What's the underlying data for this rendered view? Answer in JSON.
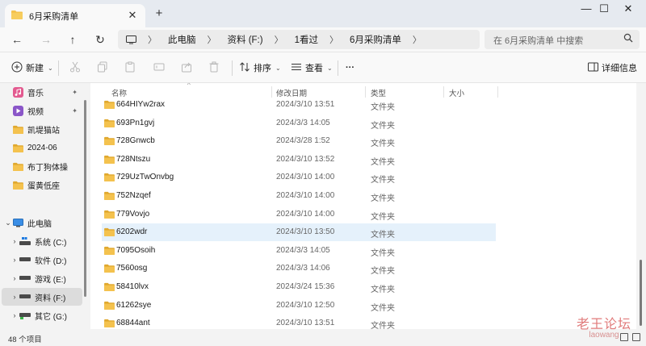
{
  "tab": {
    "title": "6月采购清单",
    "close": "✕",
    "new_tab": "+"
  },
  "window": {
    "minimize": "—",
    "maximize": "☐",
    "close": "✕"
  },
  "nav": {
    "back": "←",
    "forward": "→",
    "up": "↑",
    "refresh": "↻"
  },
  "breadcrumb": [
    "此电脑",
    "资料 (F:)",
    "1看过",
    "6月采购清单"
  ],
  "breadcrumb_sep": "〉",
  "search": {
    "placeholder": "在 6月采购清单 中搜索"
  },
  "toolbar": {
    "new_label": "新建",
    "sort_label": "排序",
    "view_label": "查看",
    "more_label": "···",
    "details_label": "详细信息",
    "caret": "⌄"
  },
  "sidebar": {
    "pinned": [
      {
        "label": "音乐",
        "icon": "music-icon",
        "pinned": true
      },
      {
        "label": "视频",
        "icon": "video-icon",
        "pinned": true
      },
      {
        "label": "凯堤猫站",
        "icon": "folder-icon",
        "pinned": false
      },
      {
        "label": "2024-06",
        "icon": "folder-icon",
        "pinned": false
      },
      {
        "label": "布丁狗体操",
        "icon": "folder-icon",
        "pinned": false
      },
      {
        "label": "蛋黄低座",
        "icon": "folder-icon",
        "pinned": false
      }
    ],
    "this_pc": "此电脑",
    "drives": [
      {
        "label": "系统 (C:)",
        "icon": "system-drive-icon"
      },
      {
        "label": "软件 (D:)",
        "icon": "drive-icon"
      },
      {
        "label": "游戏 (E:)",
        "icon": "drive-icon"
      },
      {
        "label": "资料 (F:)",
        "icon": "drive-icon",
        "selected": true
      },
      {
        "label": "其它 (G:)",
        "icon": "network-drive-icon"
      }
    ],
    "pin_glyph": "📌"
  },
  "columns": {
    "name": "名称",
    "date": "修改日期",
    "type": "类型",
    "size": "大小",
    "sort_glyph": "^"
  },
  "files": [
    {
      "name": "664HIYw2rax",
      "date": "2024/3/10 13:51",
      "type": "文件夹"
    },
    {
      "name": "693Pn1gvj",
      "date": "2024/3/3 14:05",
      "type": "文件夹"
    },
    {
      "name": "728Gnwcb",
      "date": "2024/3/28 1:52",
      "type": "文件夹"
    },
    {
      "name": "728Ntszu",
      "date": "2024/3/10 13:52",
      "type": "文件夹"
    },
    {
      "name": "729UzTwOnvbg",
      "date": "2024/3/10 14:00",
      "type": "文件夹"
    },
    {
      "name": "752Nzqef",
      "date": "2024/3/10 14:00",
      "type": "文件夹"
    },
    {
      "name": "779Vovjo",
      "date": "2024/3/10 14:00",
      "type": "文件夹"
    },
    {
      "name": "6202wdr",
      "date": "2024/3/10 13:50",
      "type": "文件夹",
      "highlighted": true
    },
    {
      "name": "7095Osoih",
      "date": "2024/3/3 14:05",
      "type": "文件夹"
    },
    {
      "name": "7560osg",
      "date": "2024/3/3 14:06",
      "type": "文件夹"
    },
    {
      "name": "58410lvx",
      "date": "2024/3/24 15:36",
      "type": "文件夹"
    },
    {
      "name": "61262sye",
      "date": "2024/3/10 12:50",
      "type": "文件夹"
    },
    {
      "name": "68844ant",
      "date": "2024/3/10 13:51",
      "type": "文件夹"
    }
  ],
  "status": {
    "item_count": "48 个项目"
  },
  "watermark": {
    "line1": "老王论坛",
    "line2": "laowang"
  },
  "colors": {
    "folder": "#f4c24e",
    "folder_dark": "#e0a82e",
    "highlight": "#e5f1fb",
    "accent": "#0067c0"
  }
}
